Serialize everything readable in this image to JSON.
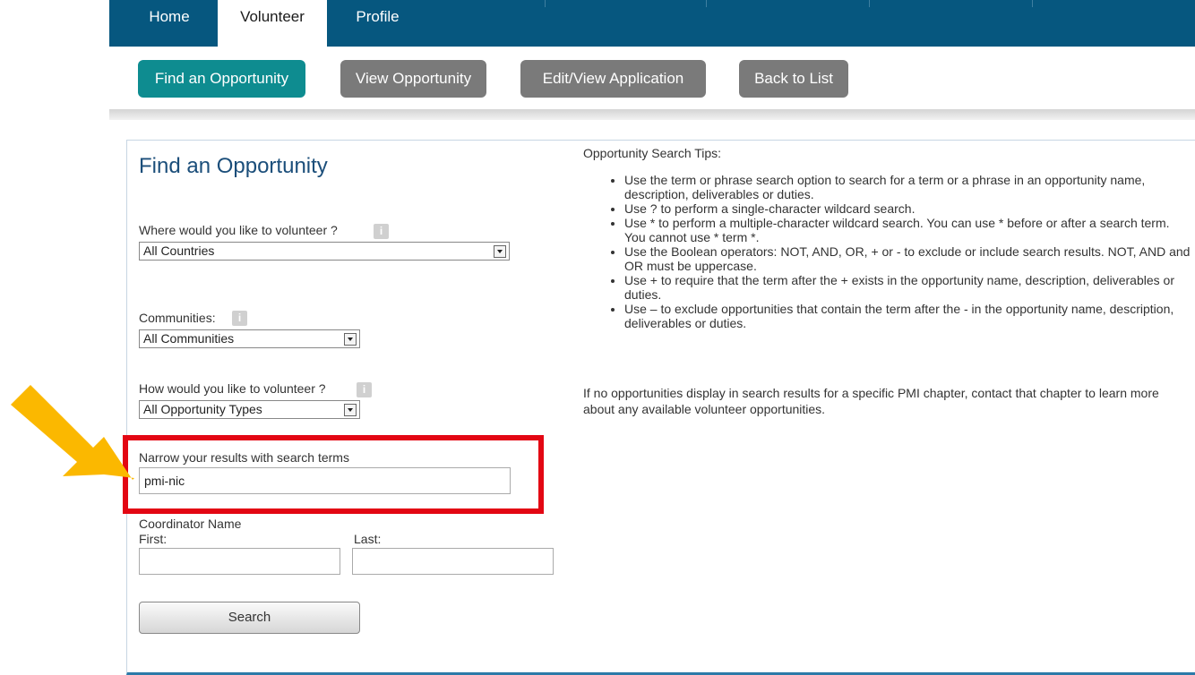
{
  "nav": {
    "tabs": [
      {
        "label": "Home",
        "active": false
      },
      {
        "label": "Volunteer",
        "active": true
      },
      {
        "label": "Profile",
        "active": false
      }
    ]
  },
  "subnav": {
    "buttons": [
      {
        "label": "Find an Opportunity",
        "active": true
      },
      {
        "label": "View Opportunity",
        "active": false
      },
      {
        "label": "Edit/View Application",
        "active": false
      },
      {
        "label": "Back to List",
        "active": false
      }
    ]
  },
  "form": {
    "title": "Find an Opportunity",
    "where_label": "Where would you like to volunteer ?",
    "where_value": "All Countries",
    "communities_label": "Communities:",
    "communities_value": "All Communities",
    "how_label": "How would you like to volunteer ?",
    "how_value": "All Opportunity Types",
    "search_terms_label": "Narrow your results with search terms",
    "search_terms_value": "pmi-nic",
    "coordinator_label": "Coordinator Name",
    "first_label": "First:",
    "last_label": "Last:",
    "first_value": "",
    "last_value": "",
    "search_button": "Search"
  },
  "tips": {
    "heading": "Opportunity Search Tips:",
    "items": [
      "Use the term or phrase search option to search for a term or a phrase in an opportunity name, description, deliverables or duties.",
      "Use ? to perform a single-character wildcard search.",
      "Use * to perform a multiple-character wildcard search. You can use * before or after a search term. You cannot use * term *.",
      "Use the Boolean operators: NOT, AND, OR, + or - to exclude or include search results. NOT, AND and OR must be uppercase.",
      "Use + to require that the term after the + exists in the opportunity name, description, deliverables or duties.",
      "Use – to exclude opportunities that contain the term after the - in the opportunity name, description, deliverables or duties."
    ],
    "note": "If no opportunities display in search results for a specific PMI chapter, contact that chapter to learn more about any available volunteer opportunities."
  },
  "colors": {
    "nav_bg": "#06577f",
    "active_button": "#0e8c90",
    "inactive_button": "#7a7a7a",
    "highlight": "#e30613",
    "arrow": "#fbb800"
  },
  "icons": {
    "info": "info-icon",
    "arrow": "pointer-arrow-icon"
  }
}
